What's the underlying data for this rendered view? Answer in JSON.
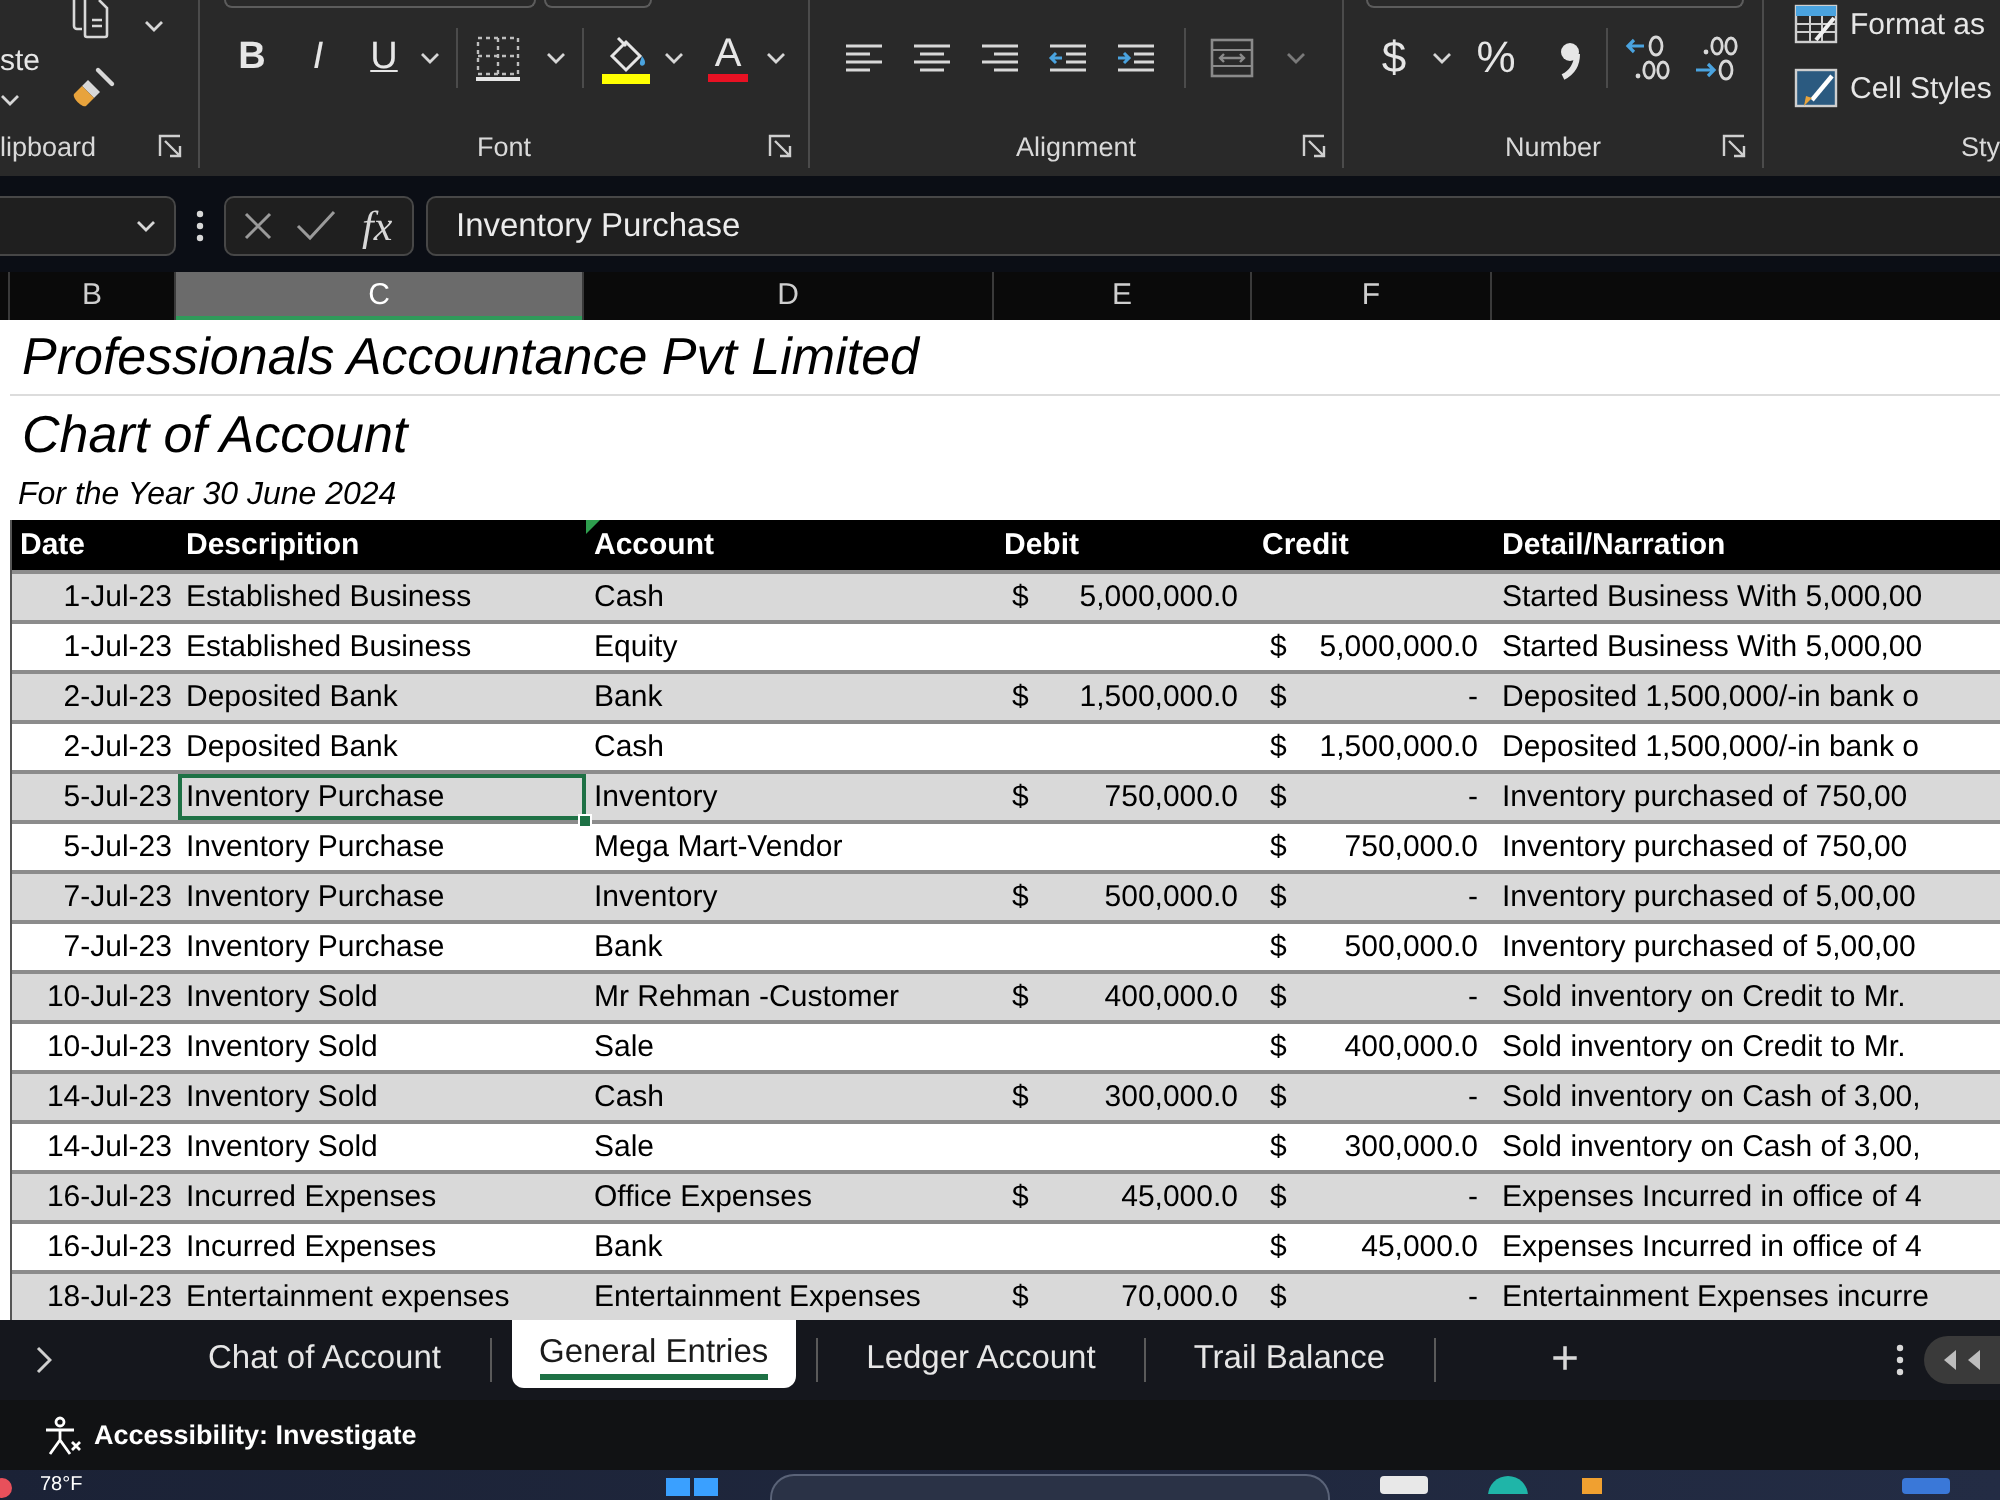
{
  "ribbon": {
    "clipboard": {
      "paste_label": "ste",
      "group_label": "lipboard"
    },
    "font": {
      "format_buttons": [
        "B",
        "I",
        "U"
      ],
      "font_color_label": "A",
      "group_label": "Font"
    },
    "alignment": {
      "group_label": "Alignment"
    },
    "number": {
      "currency_symbol": "$",
      "percent_symbol": "%",
      "group_label": "Number"
    },
    "styles": {
      "buttons": [
        "Format as",
        "Cell Styles"
      ],
      "group_label": "Sty"
    }
  },
  "formula_bar": {
    "function_label": "fx",
    "formula": "Inventory Purchase"
  },
  "column_headers": [
    {
      "label": "B",
      "selected": false
    },
    {
      "label": "C",
      "selected": true
    },
    {
      "label": "D",
      "selected": false
    },
    {
      "label": "E",
      "selected": false
    },
    {
      "label": "F",
      "selected": false
    }
  ],
  "sheet": {
    "title": "Professionals Accountance Pvt Limited",
    "subtitle": "Chart of Account",
    "period": "For the Year 30 June 2024",
    "table": {
      "columns": [
        {
          "label": "Date",
          "error_indicator": false
        },
        {
          "label": "Descripition",
          "error_indicator": false
        },
        {
          "label": "Account",
          "error_indicator": true
        },
        {
          "label": "Debit",
          "error_indicator": false
        },
        {
          "label": "Credit",
          "error_indicator": false
        },
        {
          "label": "Detail/Narration",
          "error_indicator": false
        }
      ],
      "rows": [
        {
          "date": "1-Jul-23",
          "description": "Established Business",
          "account": "Cash",
          "debit": {
            "symbol": "$",
            "amount": "5,000,000.0"
          },
          "narration": "Started Business With 5,000,00",
          "selected": false
        },
        {
          "date": "1-Jul-23",
          "description": "Established Business",
          "account": "Equity",
          "credit": {
            "symbol": "$",
            "amount": "5,000,000.0"
          },
          "narration": "Started Business With 5,000,00",
          "selected": false
        },
        {
          "date": "2-Jul-23",
          "description": "Deposited Bank",
          "account": "Bank",
          "debit": {
            "symbol": "$",
            "amount": "1,500,000.0"
          },
          "credit": {
            "symbol": "$",
            "amount": "-"
          },
          "narration": "Deposited 1,500,000/-in bank o",
          "selected": false
        },
        {
          "date": "2-Jul-23",
          "description": "Deposited Bank",
          "account": "Cash",
          "credit": {
            "symbol": "$",
            "amount": "1,500,000.0"
          },
          "narration": "Deposited 1,500,000/-in bank o",
          "selected": false
        },
        {
          "date": "5-Jul-23",
          "description": "Inventory Purchase",
          "account": "Inventory",
          "debit": {
            "symbol": "$",
            "amount": "750,000.0"
          },
          "credit": {
            "symbol": "$",
            "amount": "-"
          },
          "narration": "Inventory purchased of 750,00",
          "selected": true
        },
        {
          "date": "5-Jul-23",
          "description": "Inventory Purchase",
          "account": "Mega Mart-Vendor",
          "credit": {
            "symbol": "$",
            "amount": "750,000.0"
          },
          "narration": "Inventory purchased of 750,00",
          "selected": false
        },
        {
          "date": "7-Jul-23",
          "description": "Inventory Purchase",
          "account": "Inventory",
          "debit": {
            "symbol": "$",
            "amount": "500,000.0"
          },
          "credit": {
            "symbol": "$",
            "amount": "-"
          },
          "narration": "Inventory purchased of 5,00,00",
          "selected": false
        },
        {
          "date": "7-Jul-23",
          "description": "Inventory Purchase",
          "account": "Bank",
          "credit": {
            "symbol": "$",
            "amount": "500,000.0"
          },
          "narration": "Inventory purchased of 5,00,00",
          "selected": false
        },
        {
          "date": "10-Jul-23",
          "description": "Inventory Sold",
          "account": "Mr Rehman -Customer",
          "debit": {
            "symbol": "$",
            "amount": "400,000.0"
          },
          "credit": {
            "symbol": "$",
            "amount": "-"
          },
          "narration": "Sold inventory on Credit to Mr.",
          "selected": false
        },
        {
          "date": "10-Jul-23",
          "description": "Inventory Sold",
          "account": "Sale",
          "credit": {
            "symbol": "$",
            "amount": "400,000.0"
          },
          "narration": "Sold inventory on Credit to Mr.",
          "selected": false
        },
        {
          "date": "14-Jul-23",
          "description": "Inventory Sold",
          "account": "Cash",
          "debit": {
            "symbol": "$",
            "amount": "300,000.0"
          },
          "credit": {
            "symbol": "$",
            "amount": "-"
          },
          "narration": "Sold inventory on Cash of 3,00,",
          "selected": false
        },
        {
          "date": "14-Jul-23",
          "description": "Inventory Sold",
          "account": "Sale",
          "credit": {
            "symbol": "$",
            "amount": "300,000.0"
          },
          "narration": "Sold inventory on Cash of 3,00,",
          "selected": false
        },
        {
          "date": "16-Jul-23",
          "description": "Incurred Expenses",
          "account": "Office Expenses",
          "debit": {
            "symbol": "$",
            "amount": "45,000.0"
          },
          "credit": {
            "symbol": "$",
            "amount": "-"
          },
          "narration": "Expenses Incurred in office of 4",
          "selected": false
        },
        {
          "date": "16-Jul-23",
          "description": "Incurred Expenses",
          "account": "Bank",
          "credit": {
            "symbol": "$",
            "amount": "45,000.0"
          },
          "narration": "Expenses Incurred in office of 4",
          "selected": false
        },
        {
          "date": "18-Jul-23",
          "description": "Entertainment expenses",
          "account": "Entertainment Expenses",
          "debit": {
            "symbol": "$",
            "amount": "70,000.0"
          },
          "credit": {
            "symbol": "$",
            "amount": "-"
          },
          "narration": "Entertainment Expenses incurre",
          "selected": false
        }
      ]
    }
  },
  "sheet_tabs": {
    "tabs": [
      {
        "label": "Chat of Account",
        "selected": false
      },
      {
        "label": "General Entries",
        "selected": true
      },
      {
        "label": "Ledger Account",
        "selected": false
      },
      {
        "label": "Trail Balance",
        "selected": false
      }
    ],
    "add_label": "+"
  },
  "status_bar": {
    "accessibility": "Accessibility: Investigate"
  },
  "taskbar": {
    "weather": "78°F"
  }
}
